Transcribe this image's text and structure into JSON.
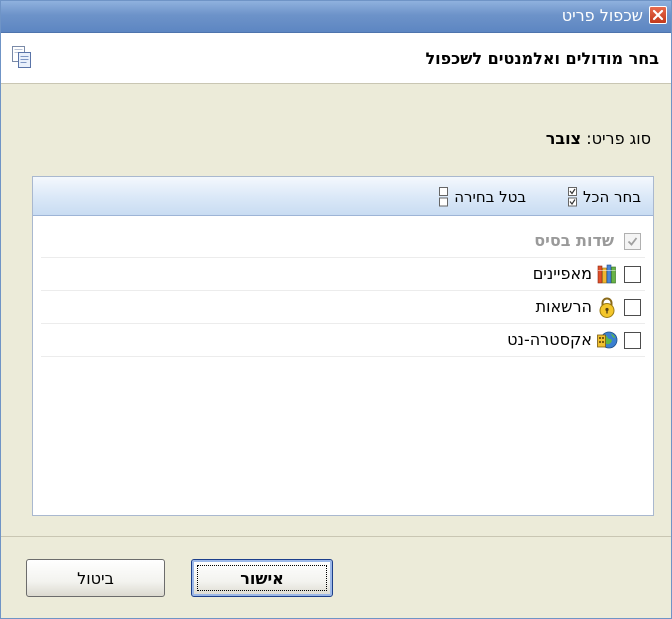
{
  "window": {
    "title": "שכפול פריט"
  },
  "header": {
    "title": "בחר מודולים ואלמנטים לשכפול"
  },
  "item_type": {
    "label": "סוג פריט:",
    "value": "צובר"
  },
  "toolbar": {
    "select_all": "בחר הכל",
    "clear_selection": "בטל בחירה"
  },
  "modules": [
    {
      "label": "שדות בסיס",
      "checked": true,
      "disabled": true,
      "icon": ""
    },
    {
      "label": "מאפיינים",
      "checked": false,
      "disabled": false,
      "icon": "books-icon"
    },
    {
      "label": "הרשאות",
      "checked": false,
      "disabled": false,
      "icon": "lock-icon"
    },
    {
      "label": "אקסטרה-נט",
      "checked": false,
      "disabled": false,
      "icon": "extranet-globe-icon"
    }
  ],
  "buttons": {
    "ok": "אישור",
    "cancel": "ביטול"
  },
  "colors": {
    "titlebar": "#6d93c9",
    "dialog_bg": "#ecebd9",
    "toolbar_bg": "#dce9f8"
  }
}
